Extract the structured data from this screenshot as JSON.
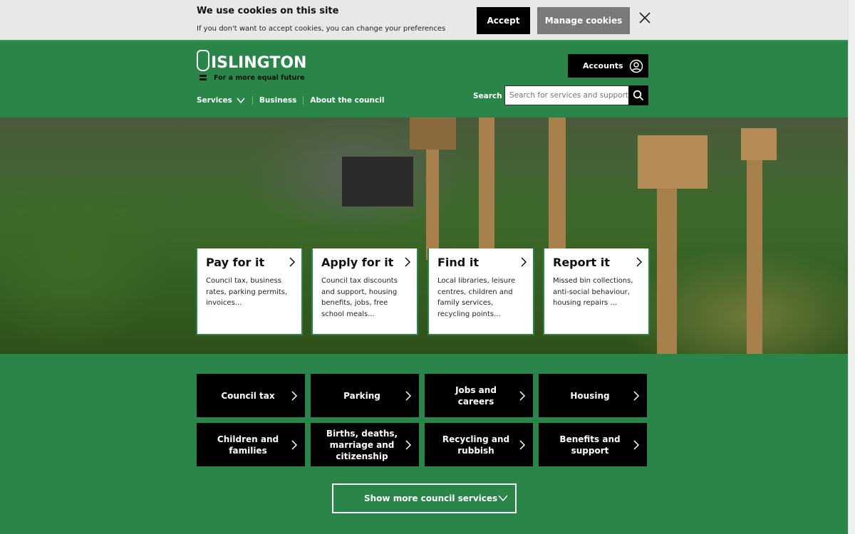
{
  "cookie_banner": {
    "title": "We use cookies on this site",
    "text": "If you don't want to accept cookies, you can change your preferences",
    "accept": "Accept",
    "manage": "Manage cookies"
  },
  "header": {
    "logo_name": "ISLINGTON",
    "tagline": "For a more equal future",
    "accounts": "Accounts",
    "search_label": "Search",
    "search_placeholder": "Search for services and support",
    "nav": [
      "Services",
      "Business",
      "About the council"
    ]
  },
  "cards": [
    {
      "title": "Pay for it",
      "text": "Council tax, business rates, parking permits, invoices..."
    },
    {
      "title": "Apply for it",
      "text": "Council tax discounts and support, housing benefits, jobs, free school meals..."
    },
    {
      "title": "Find it",
      "text": "Local libraries, leisure centres, children and family services, recycling points..."
    },
    {
      "title": "Report it",
      "text": "Missed bin collections, anti-social behaviour, housing repairs ..."
    }
  ],
  "services": [
    "Council tax",
    "Parking",
    "Jobs and careers",
    "Housing",
    "Children and families",
    "Births, deaths, marriage and citizenship",
    "Recycling and rubbish",
    "Benefits and support"
  ],
  "show_more": "Show more council services",
  "colors": {
    "brand_green": "#2a8548",
    "black": "#000000"
  }
}
